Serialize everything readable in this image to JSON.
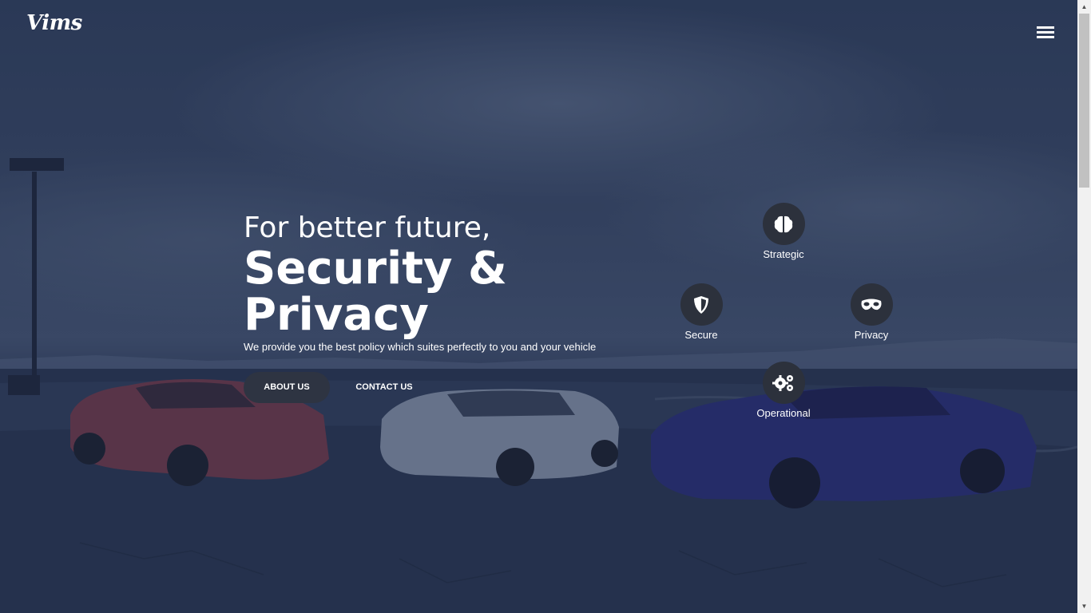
{
  "header": {
    "logo": "Vims",
    "menu_icon": "hamburger-menu-icon"
  },
  "hero": {
    "subtitle": "For better future,",
    "title": "Security & Privacy",
    "description": "We provide you the best policy which suites perfectly to you and your vehicle",
    "buttons": {
      "about": "ABOUT US",
      "contact": "CONTACT US"
    }
  },
  "features": [
    {
      "label": "Strategic",
      "icon": "brain-icon"
    },
    {
      "label": "Secure",
      "icon": "shield-icon"
    },
    {
      "label": "Privacy",
      "icon": "mask-icon"
    },
    {
      "label": "Operational",
      "icon": "gears-icon"
    }
  ],
  "colors": {
    "overlay": "#19284b",
    "button_dark": "#2e3442",
    "icon_circle": "#2c313c",
    "text": "#ffffff"
  }
}
